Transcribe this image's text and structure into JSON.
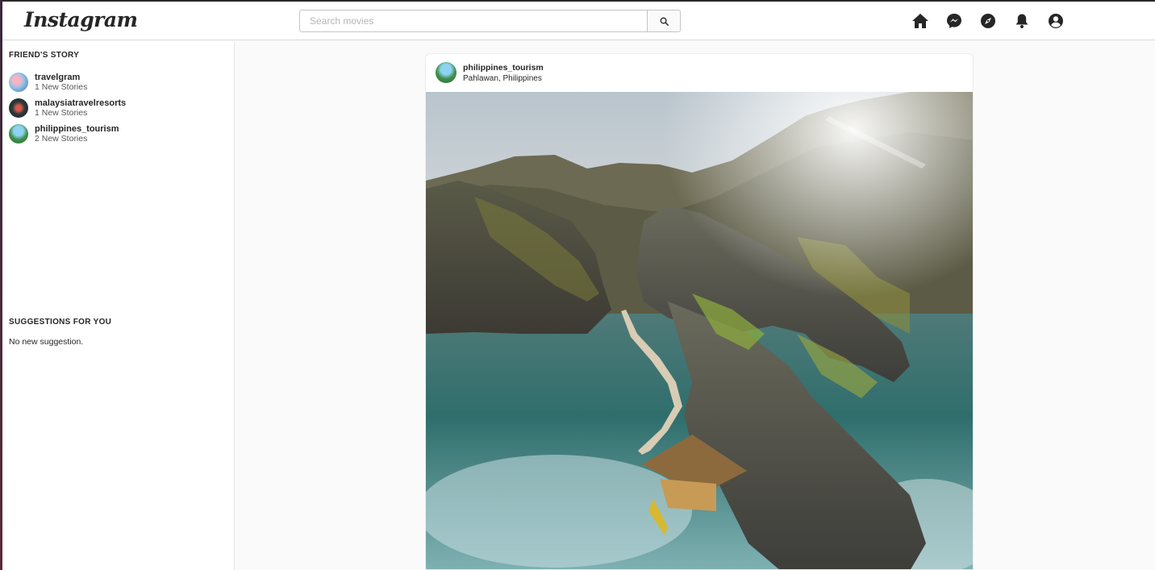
{
  "header": {
    "logo": "Instagram",
    "search_placeholder": "Search movies",
    "icons": [
      "home-icon",
      "messenger-icon",
      "explore-icon",
      "notifications-icon",
      "profile-icon"
    ]
  },
  "sidebar": {
    "stories_title": "FRIEND'S STORY",
    "stories": [
      {
        "name": "travelgram",
        "sub": "1 New Stories"
      },
      {
        "name": "malaysiatravelresorts",
        "sub": "1 New Stories"
      },
      {
        "name": "philippines_tourism",
        "sub": "2 New Stories"
      }
    ],
    "suggestions_title": "SUGGESTIONS FOR YOU",
    "suggestions_empty": "No new suggestion."
  },
  "post": {
    "username": "philippines_tourism",
    "location": "Pahlawan, Philippines"
  },
  "colors": {
    "text": "#262626",
    "border": "#dbdbdb",
    "background": "#fafafa"
  }
}
